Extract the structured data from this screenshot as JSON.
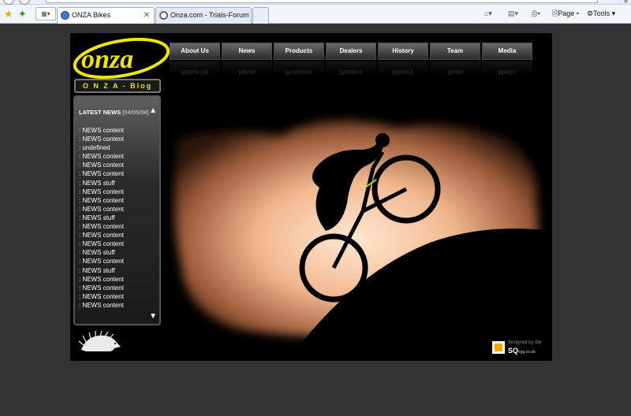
{
  "browser": {
    "tabs": [
      {
        "title": "ONZA Bikes",
        "active": true
      },
      {
        "title": "Onza.com - Trials-Forum",
        "active": false
      }
    ],
    "commands": {
      "page_label": "Page",
      "tools_label": "Tools",
      "more_label": "»"
    }
  },
  "site": {
    "logo_text": "onza",
    "nav": [
      "About Us",
      "News",
      "Products",
      "Dealers",
      "History",
      "Team",
      "Media"
    ],
    "blog_button": "O N Z A  -  Blog",
    "news": {
      "heading": "LATEST NEWS",
      "date": "[04/05/08]",
      "items": [
        ": NEWS content",
        ": NEWS content",
        ": undefined",
        ": NEWS content",
        ": NEWS content",
        ": NEWS content",
        ": NEWS stuff",
        ": NEWS content",
        ": NEWS content",
        ": NEWS content",
        ": NEWS stuff",
        ": NEWS content",
        ": NEWS content",
        ": NEWS content",
        ": NEWS stuff",
        ": NEWS content",
        ": NEWS stuff",
        ": NEWS content",
        ": NEWS content",
        ": NEWS content",
        ": NEWS content"
      ]
    },
    "credit": {
      "line1": "designed by the",
      "brand": "SQ",
      "brand_suffix": "egg",
      "domain": ".co.uk"
    }
  },
  "colors": {
    "logo_yellow": "#f2e600",
    "page_bg": "#333333",
    "site_bg": "#000000",
    "badge_orange": "#f5a800"
  }
}
